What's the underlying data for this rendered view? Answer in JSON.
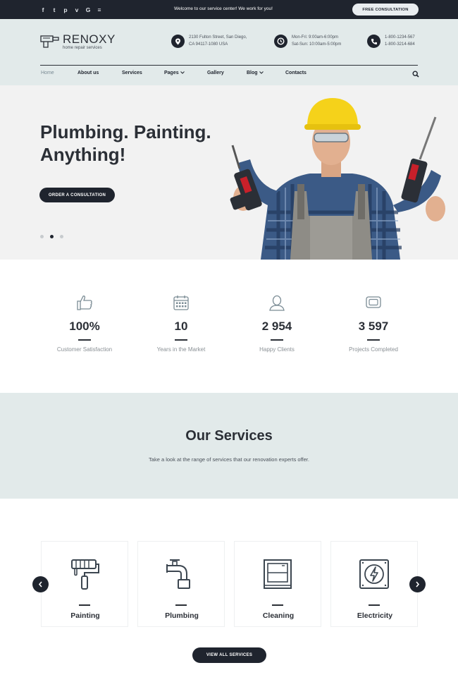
{
  "topbar": {
    "social_icons": [
      "facebook-icon",
      "twitter-icon",
      "pinterest-icon",
      "vimeo-icon",
      "google-icon",
      "rss-icon"
    ],
    "social_glyphs": [
      "f",
      "t",
      "p",
      "v",
      "G",
      "≡"
    ],
    "welcome": "Welcome to our service center! We work for you!",
    "cta": "FREE CONSULTATION"
  },
  "header": {
    "logo_name": "RENOXY",
    "logo_sub": "home repair services",
    "address": [
      "2130 Fulton Street, San Diego,",
      "CA 94117-1080 USA"
    ],
    "hours": [
      "Mon-Fri: 9:00am-6:00pm",
      "Sat-Sun: 10:00am-5:00pm"
    ],
    "phones": [
      "1-800-1234-567",
      "1-800-3214-684"
    ]
  },
  "nav": {
    "items": [
      "Home",
      "About us",
      "Services",
      "Pages",
      "Gallery",
      "Blog",
      "Contacts"
    ],
    "active": "Home"
  },
  "hero": {
    "title": "Plumbing. Painting.\nAnything!",
    "button": "ORDER A CONSULTATION",
    "slides": 3,
    "active_slide": 2
  },
  "stats": [
    {
      "value": "100%",
      "label": "Customer Satisfaction",
      "icon": "thumbs-up-icon"
    },
    {
      "value": "10",
      "label": "Years in the Market",
      "icon": "calendar-icon"
    },
    {
      "value": "2 954",
      "label": "Happy Clients",
      "icon": "user-icon"
    },
    {
      "value": "3 597",
      "label": "Projects Completed",
      "icon": "monitor-icon"
    }
  ],
  "services_section": {
    "title": "Our Services",
    "subtitle": "Take a look at the range of services that our renovation experts offer.",
    "cards": [
      {
        "label": "Painting",
        "icon": "paint-roller-icon"
      },
      {
        "label": "Plumbing",
        "icon": "pipe-icon"
      },
      {
        "label": "Cleaning",
        "icon": "window-icon"
      },
      {
        "label": "Electricity",
        "icon": "electric-box-icon"
      }
    ],
    "view_all": "VIEW ALL SERVICES"
  },
  "colors": {
    "dark": "#1f242e",
    "header_bg": "#e2eaea",
    "hero_bg": "#f2f2f2",
    "helmet": "#f5d21a"
  }
}
